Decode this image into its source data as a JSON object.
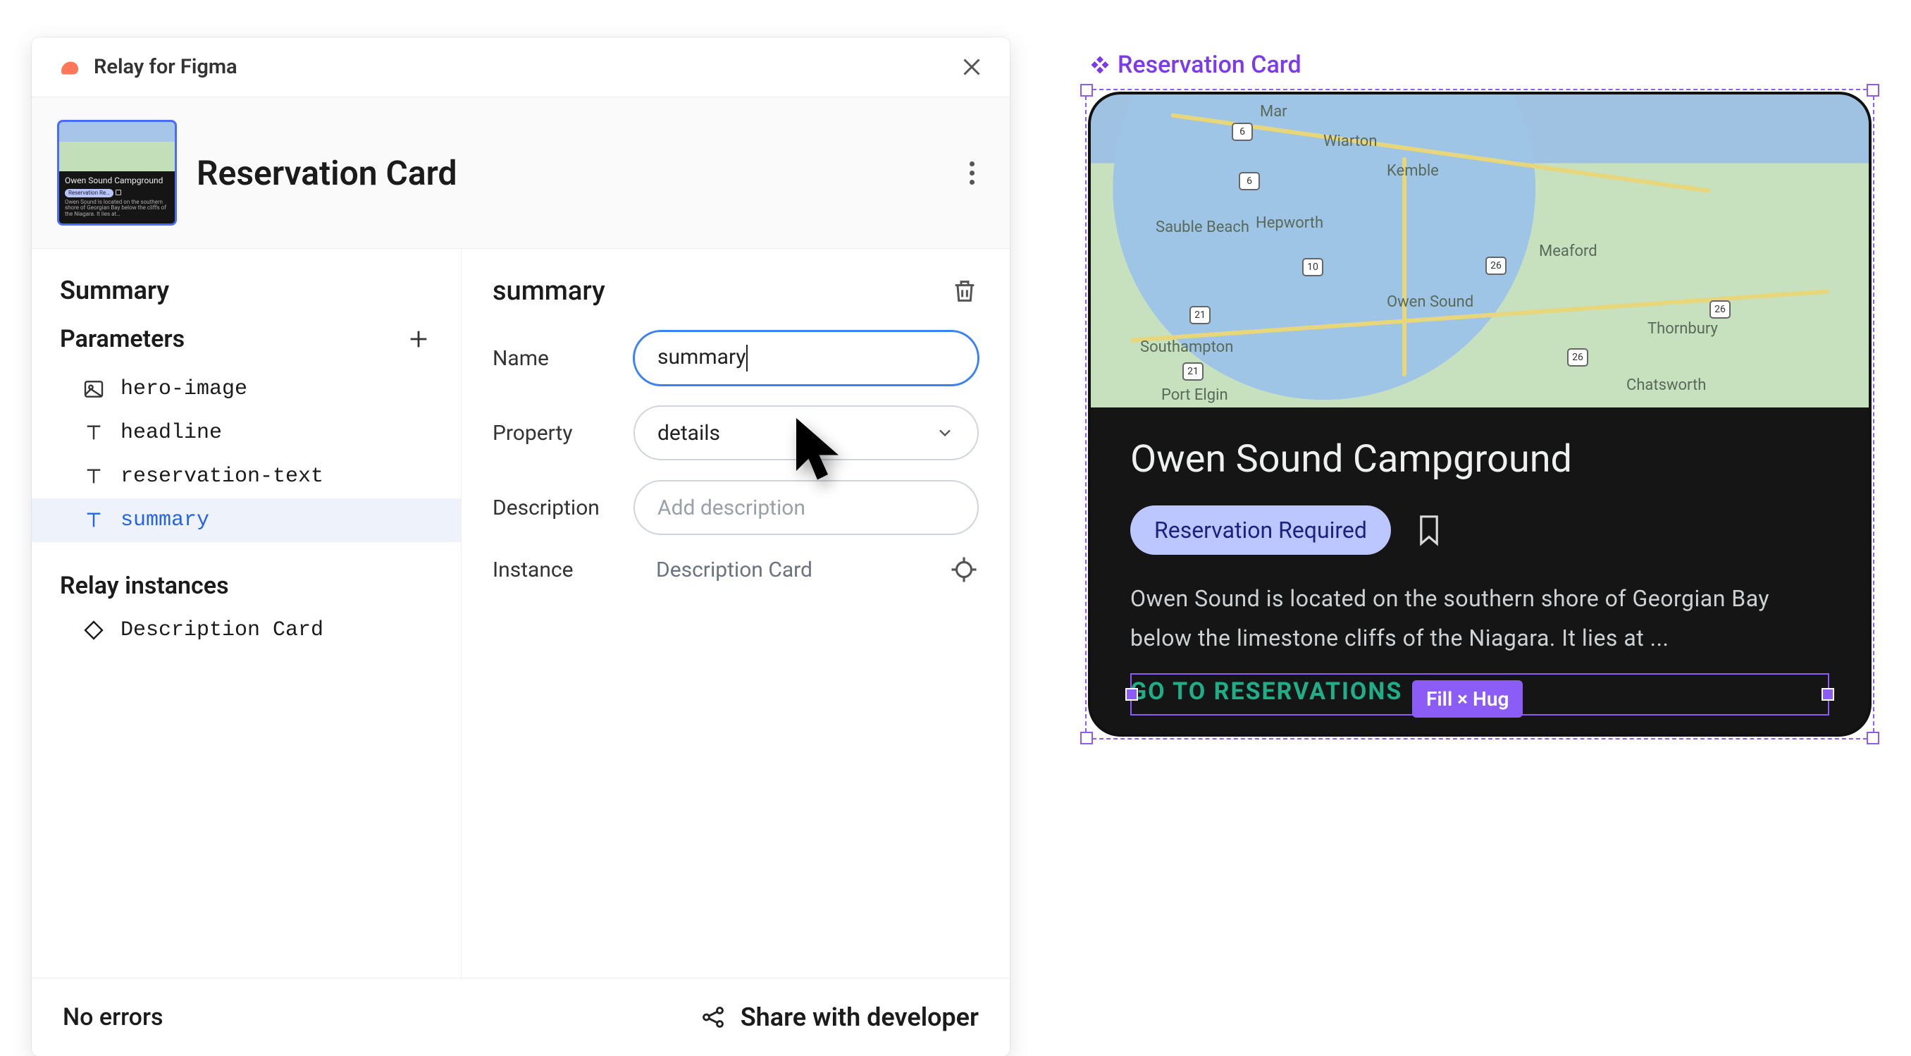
{
  "panel": {
    "app_title": "Relay for Figma",
    "component_name": "Reservation Card",
    "left": {
      "summary_heading": "Summary",
      "parameters_heading": "Parameters",
      "params": [
        {
          "icon": "image",
          "name": "hero-image"
        },
        {
          "icon": "text",
          "name": "headline"
        },
        {
          "icon": "text",
          "name": "reservation-text"
        },
        {
          "icon": "text",
          "name": "summary",
          "selected": true
        }
      ],
      "instances_heading": "Relay instances",
      "instances": [
        {
          "icon": "diamond",
          "name": "Description Card"
        }
      ]
    },
    "detail": {
      "title": "summary",
      "name_label": "Name",
      "name_value": "summary",
      "property_label": "Property",
      "property_value": "details",
      "description_label": "Description",
      "description_placeholder": "Add description",
      "instance_label": "Instance",
      "instance_value": "Description Card"
    },
    "footer": {
      "status": "No errors",
      "share": "Share with developer"
    }
  },
  "canvas": {
    "frame_label": "Reservation Card",
    "autolayout_badge": "Fill × Hug",
    "map_labels": [
      "Mar",
      "Wiarton",
      "Kemble",
      "Sauble Beach",
      "Hepworth",
      "Owen Sound",
      "Meaford",
      "Thornbury",
      "Southampton",
      "Port Elgin",
      "Chatsworth"
    ],
    "map_shields": [
      "6",
      "6",
      "10",
      "21",
      "26",
      "26",
      "21",
      "26"
    ],
    "card": {
      "title": "Owen Sound Campground",
      "chip": "Reservation Required",
      "description": "Owen Sound is located on the southern shore of Georgian Bay below the limestone cliffs of the Niagara. It lies at ...",
      "cta": "GO TO RESERVATIONS"
    }
  }
}
